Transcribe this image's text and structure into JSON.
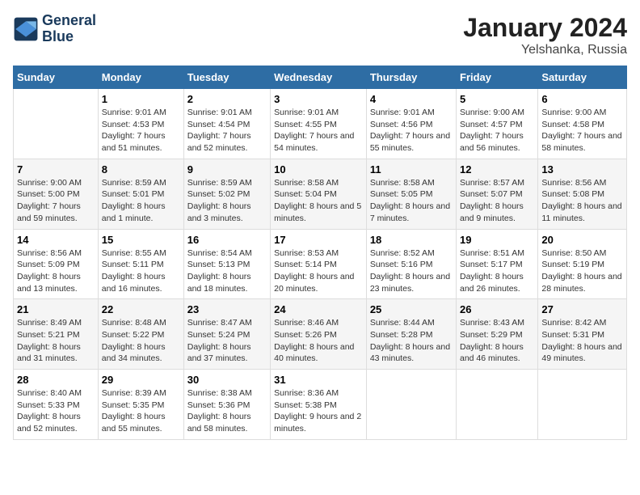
{
  "logo": {
    "line1": "General",
    "line2": "Blue"
  },
  "title": "January 2024",
  "subtitle": "Yelshanka, Russia",
  "weekdays": [
    "Sunday",
    "Monday",
    "Tuesday",
    "Wednesday",
    "Thursday",
    "Friday",
    "Saturday"
  ],
  "weeks": [
    [
      {
        "day": null,
        "sunrise": null,
        "sunset": null,
        "daylight": null
      },
      {
        "day": "1",
        "sunrise": "9:01 AM",
        "sunset": "4:53 PM",
        "daylight": "7 hours and 51 minutes."
      },
      {
        "day": "2",
        "sunrise": "9:01 AM",
        "sunset": "4:54 PM",
        "daylight": "7 hours and 52 minutes."
      },
      {
        "day": "3",
        "sunrise": "9:01 AM",
        "sunset": "4:55 PM",
        "daylight": "7 hours and 54 minutes."
      },
      {
        "day": "4",
        "sunrise": "9:01 AM",
        "sunset": "4:56 PM",
        "daylight": "7 hours and 55 minutes."
      },
      {
        "day": "5",
        "sunrise": "9:00 AM",
        "sunset": "4:57 PM",
        "daylight": "7 hours and 56 minutes."
      },
      {
        "day": "6",
        "sunrise": "9:00 AM",
        "sunset": "4:58 PM",
        "daylight": "7 hours and 58 minutes."
      }
    ],
    [
      {
        "day": "7",
        "sunrise": "9:00 AM",
        "sunset": "5:00 PM",
        "daylight": "7 hours and 59 minutes."
      },
      {
        "day": "8",
        "sunrise": "8:59 AM",
        "sunset": "5:01 PM",
        "daylight": "8 hours and 1 minute."
      },
      {
        "day": "9",
        "sunrise": "8:59 AM",
        "sunset": "5:02 PM",
        "daylight": "8 hours and 3 minutes."
      },
      {
        "day": "10",
        "sunrise": "8:58 AM",
        "sunset": "5:04 PM",
        "daylight": "8 hours and 5 minutes."
      },
      {
        "day": "11",
        "sunrise": "8:58 AM",
        "sunset": "5:05 PM",
        "daylight": "8 hours and 7 minutes."
      },
      {
        "day": "12",
        "sunrise": "8:57 AM",
        "sunset": "5:07 PM",
        "daylight": "8 hours and 9 minutes."
      },
      {
        "day": "13",
        "sunrise": "8:56 AM",
        "sunset": "5:08 PM",
        "daylight": "8 hours and 11 minutes."
      }
    ],
    [
      {
        "day": "14",
        "sunrise": "8:56 AM",
        "sunset": "5:09 PM",
        "daylight": "8 hours and 13 minutes."
      },
      {
        "day": "15",
        "sunrise": "8:55 AM",
        "sunset": "5:11 PM",
        "daylight": "8 hours and 16 minutes."
      },
      {
        "day": "16",
        "sunrise": "8:54 AM",
        "sunset": "5:13 PM",
        "daylight": "8 hours and 18 minutes."
      },
      {
        "day": "17",
        "sunrise": "8:53 AM",
        "sunset": "5:14 PM",
        "daylight": "8 hours and 20 minutes."
      },
      {
        "day": "18",
        "sunrise": "8:52 AM",
        "sunset": "5:16 PM",
        "daylight": "8 hours and 23 minutes."
      },
      {
        "day": "19",
        "sunrise": "8:51 AM",
        "sunset": "5:17 PM",
        "daylight": "8 hours and 26 minutes."
      },
      {
        "day": "20",
        "sunrise": "8:50 AM",
        "sunset": "5:19 PM",
        "daylight": "8 hours and 28 minutes."
      }
    ],
    [
      {
        "day": "21",
        "sunrise": "8:49 AM",
        "sunset": "5:21 PM",
        "daylight": "8 hours and 31 minutes."
      },
      {
        "day": "22",
        "sunrise": "8:48 AM",
        "sunset": "5:22 PM",
        "daylight": "8 hours and 34 minutes."
      },
      {
        "day": "23",
        "sunrise": "8:47 AM",
        "sunset": "5:24 PM",
        "daylight": "8 hours and 37 minutes."
      },
      {
        "day": "24",
        "sunrise": "8:46 AM",
        "sunset": "5:26 PM",
        "daylight": "8 hours and 40 minutes."
      },
      {
        "day": "25",
        "sunrise": "8:44 AM",
        "sunset": "5:28 PM",
        "daylight": "8 hours and 43 minutes."
      },
      {
        "day": "26",
        "sunrise": "8:43 AM",
        "sunset": "5:29 PM",
        "daylight": "8 hours and 46 minutes."
      },
      {
        "day": "27",
        "sunrise": "8:42 AM",
        "sunset": "5:31 PM",
        "daylight": "8 hours and 49 minutes."
      }
    ],
    [
      {
        "day": "28",
        "sunrise": "8:40 AM",
        "sunset": "5:33 PM",
        "daylight": "8 hours and 52 minutes."
      },
      {
        "day": "29",
        "sunrise": "8:39 AM",
        "sunset": "5:35 PM",
        "daylight": "8 hours and 55 minutes."
      },
      {
        "day": "30",
        "sunrise": "8:38 AM",
        "sunset": "5:36 PM",
        "daylight": "8 hours and 58 minutes."
      },
      {
        "day": "31",
        "sunrise": "8:36 AM",
        "sunset": "5:38 PM",
        "daylight": "9 hours and 2 minutes."
      },
      {
        "day": null,
        "sunrise": null,
        "sunset": null,
        "daylight": null
      },
      {
        "day": null,
        "sunrise": null,
        "sunset": null,
        "daylight": null
      },
      {
        "day": null,
        "sunrise": null,
        "sunset": null,
        "daylight": null
      }
    ]
  ],
  "labels": {
    "sunrise": "Sunrise:",
    "sunset": "Sunset:",
    "daylight": "Daylight:"
  }
}
